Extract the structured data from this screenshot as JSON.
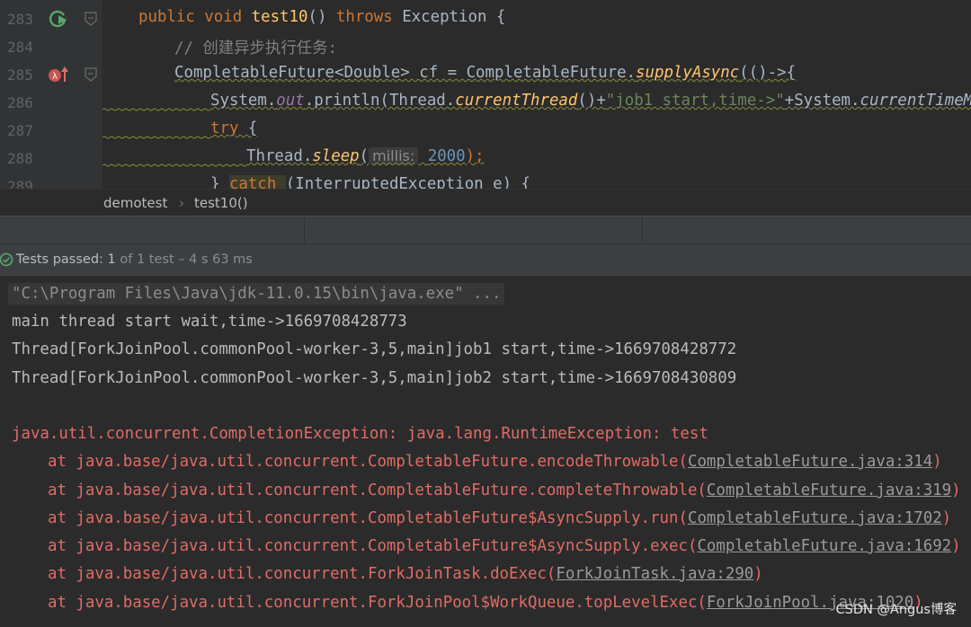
{
  "editor": {
    "lines": [
      {
        "no": "283",
        "kw1": "public void ",
        "fn": "test10",
        "rest1": "() ",
        "kw2": "throws ",
        "rest2": "Exception {"
      },
      {
        "no": "284",
        "comment": "// 创建异步执行任务:"
      },
      {
        "no": "285",
        "a": "CompletableFuture<Double> cf = CompletableFuture.",
        "b": "supplyAsync",
        "c": "(()->{"
      },
      {
        "no": "286",
        "a": "System.",
        "b": "out",
        "c": ".println(Thread.",
        "d": "currentThread",
        "e": "()+",
        "f": "\"job1 start,time->\"",
        "g": "+System.",
        "h": "currentTimeMillis"
      },
      {
        "no": "287",
        "kw": "try ",
        "rest": "{"
      },
      {
        "no": "288",
        "a": "Thread.",
        "b": "sleep",
        "c": "(",
        "hint": "millis:",
        "num": "2000",
        "d": ");"
      },
      {
        "no": "289",
        "a": "} ",
        "kw": "catch ",
        "b": "(InterruptedException e) {"
      }
    ]
  },
  "breadcrumb": {
    "item1": "demotest",
    "sep": "›",
    "item2": "test10()"
  },
  "status": {
    "label": "Tests passed: ",
    "count": "1",
    "of": " of 1 test",
    "time": " – 4 s 63 ms"
  },
  "console": {
    "cmd": "\"C:\\Program Files\\Java\\jdk-11.0.15\\bin\\java.exe\" ...",
    "out": [
      "main thread start wait,time->1669708428773",
      "Thread[ForkJoinPool.commonPool-worker-3,5,main]job1 start,time->1669708428772",
      "Thread[ForkJoinPool.commonPool-worker-3,5,main]job2 start,time->1669708430809"
    ],
    "exception": "java.util.concurrent.CompletionException: java.lang.RuntimeException: test",
    "trace": [
      {
        "at": "at java.base/java.util.concurrent.CompletableFuture.encodeThrowable(",
        "link": "CompletableFuture.java:314",
        "end": ")"
      },
      {
        "at": "at java.base/java.util.concurrent.CompletableFuture.completeThrowable(",
        "link": "CompletableFuture.java:319",
        "end": ")"
      },
      {
        "at": "at java.base/java.util.concurrent.CompletableFuture$AsyncSupply.run(",
        "link": "CompletableFuture.java:1702",
        "end": ")"
      },
      {
        "at": "at java.base/java.util.concurrent.CompletableFuture$AsyncSupply.exec(",
        "link": "CompletableFuture.java:1692",
        "end": ")"
      },
      {
        "at": "at java.base/java.util.concurrent.ForkJoinTask.doExec(",
        "link": "ForkJoinTask.java:290",
        "end": ")"
      },
      {
        "at": "at java.base/java.util.concurrent.ForkJoinPool$WorkQueue.topLevelExec(",
        "link": "ForkJoinPool.java:1020",
        "end": ")"
      }
    ]
  },
  "watermark": "CSDN @Angus博客",
  "colors": {
    "keyword": "#cc7832",
    "method": "#ffc66d",
    "error": "#e06c66",
    "pass": "#59a869"
  },
  "icons": [
    "run-test-icon",
    "exception-breakpoint-icon",
    "fold-marker-icon",
    "check-pass-icon"
  ]
}
